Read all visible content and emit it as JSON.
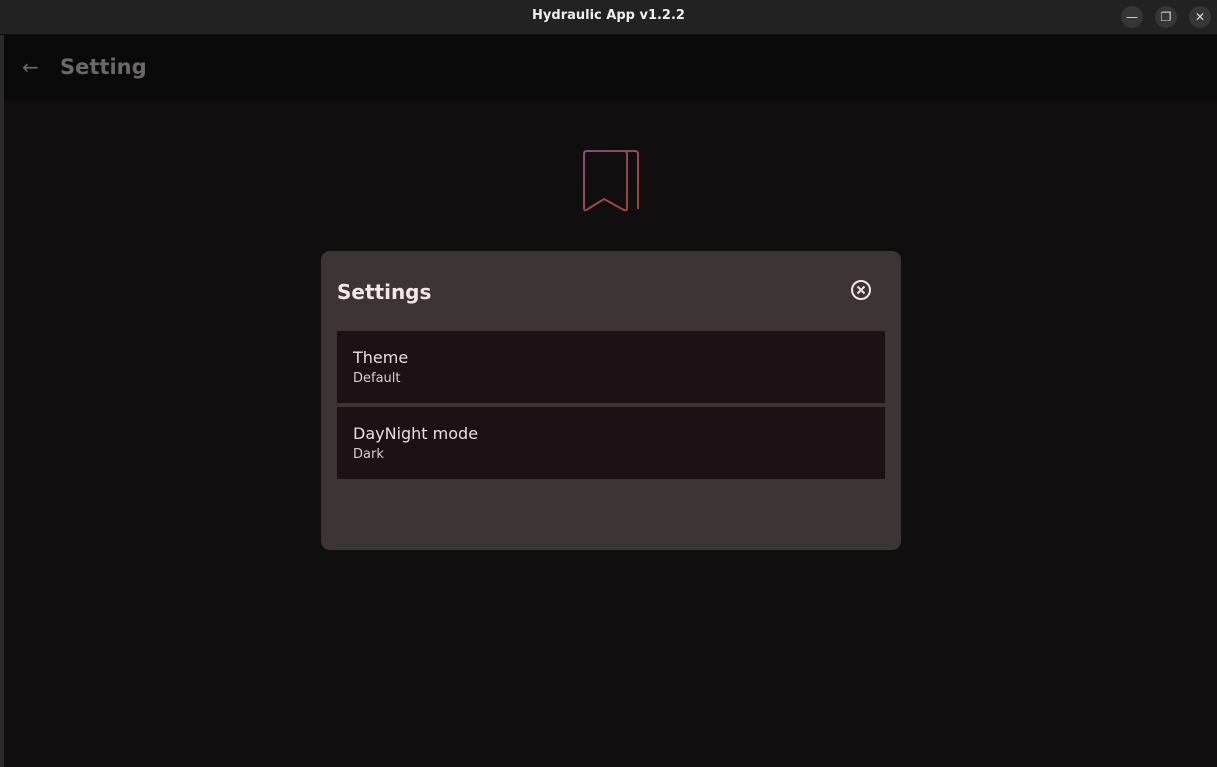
{
  "window": {
    "title": "Hydraulic App v1.2.2",
    "minimize": "—",
    "maximize": "❐",
    "close": "✕"
  },
  "header": {
    "back_icon": "←",
    "title": "Setting"
  },
  "dialog": {
    "title": "Settings",
    "items": [
      {
        "label": "Theme",
        "value": "Default"
      },
      {
        "label": "DayNight mode",
        "value": "Dark"
      }
    ]
  }
}
